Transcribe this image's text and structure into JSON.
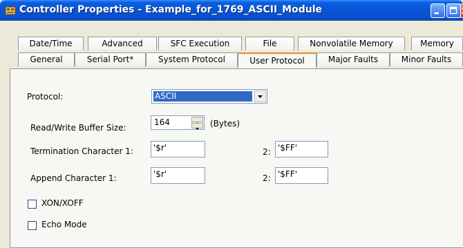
{
  "window": {
    "title": "Controller Properties - Example_for_1769_ASCII_Module"
  },
  "tabs_row1": [
    "Date/Time",
    "Advanced",
    "SFC Execution",
    "File",
    "Nonvolatile Memory",
    "Memory"
  ],
  "tabs_row2": [
    "General",
    "Serial Port*",
    "System Protocol",
    "User Protocol",
    "Major Faults",
    "Minor Faults"
  ],
  "active_tab": "User Protocol",
  "form": {
    "protocol_label": "Protocol:",
    "protocol_value": "ASCII",
    "buffer_label": "Read/Write Buffer Size:",
    "buffer_value": "164",
    "buffer_unit": "(Bytes)",
    "term_label": "Termination Character 1:",
    "term_value1": "'$r'",
    "term_label2": "2:",
    "term_value2": "'$FF'",
    "append_label": "Append Character 1:",
    "append_value1": "'$r'",
    "append_label2": "2:",
    "append_value2": "'$FF'",
    "xon_label": "XON/XOFF",
    "xon_checked": false,
    "echo_label": "Echo Mode",
    "echo_checked": false
  },
  "icons": {
    "app": "controller-properties-icon",
    "minimize": "minimize-icon",
    "maximize": "maximize-icon",
    "close": "close-icon",
    "dropdown": "chevron-down-icon",
    "spin": "spin-arrows-icon"
  },
  "colors": {
    "titlebar": "#0854d8",
    "selection": "#316ac5",
    "active_tab_accent": "#e68b2c",
    "dialog_bg": "#ece9d8"
  }
}
